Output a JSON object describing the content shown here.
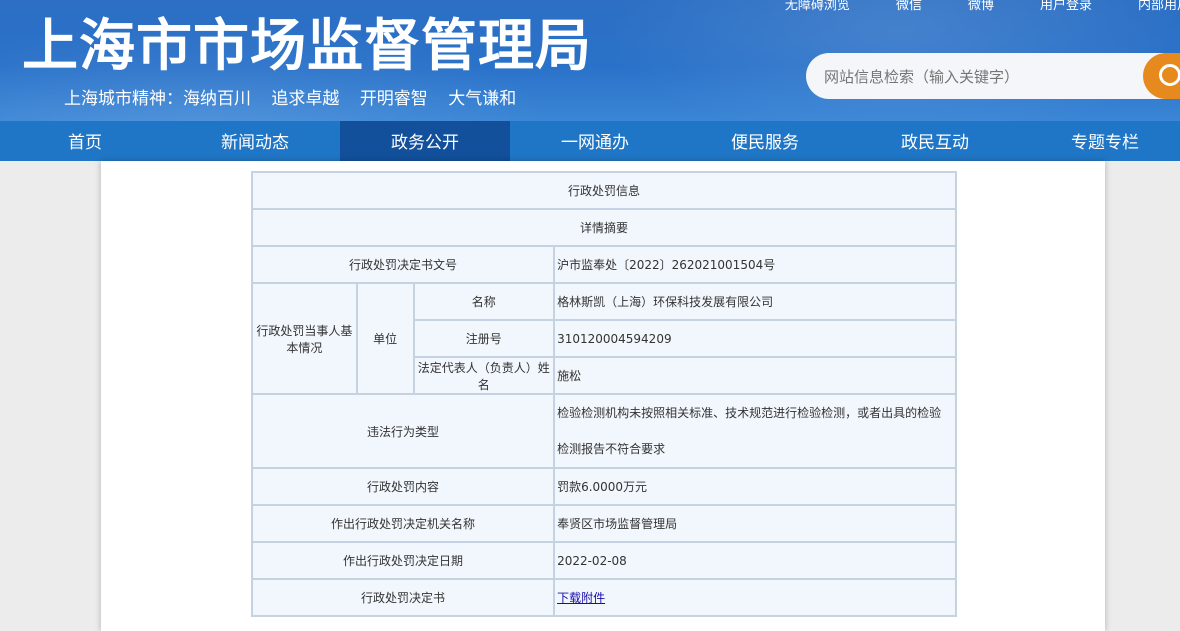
{
  "header": {
    "site_title": "上海市市场监督管理局",
    "slogan": [
      "上海城市精神：海纳百川",
      "追求卓越",
      "开明睿智",
      "大气谦和"
    ],
    "top_links": [
      "无障碍浏览",
      "微信",
      "微博",
      "用户登录",
      "内部用户"
    ],
    "search_placeholder": "网站信息检索（输入关键字）"
  },
  "nav": {
    "items": [
      "首页",
      "新闻动态",
      "政务公开",
      "一网通办",
      "便民服务",
      "政民互动",
      "专题专栏"
    ],
    "active_index": 2
  },
  "table": {
    "title": "行政处罚信息",
    "subtitle": "详情摘要",
    "doc_no_label": "行政处罚决定书文号",
    "doc_no_value": "沪市监奉处〔2022〕262021001504号",
    "party_label": "行政处罚当事人基本情况",
    "unit_label": "单位",
    "name_label": "名称",
    "name_value": "格林斯凯（上海）环保科技发展有限公司",
    "reg_label": "注册号",
    "reg_value": "310120004594209",
    "rep_label": "法定代表人（负责人）姓名",
    "rep_value": "施松",
    "violation_label": "违法行为类型",
    "violation_value": "检验检测机构未按照相关标准、技术规范进行检验检测，或者出具的检验检测报告不符合要求",
    "content_label": "行政处罚内容",
    "content_value": "罚款6.0000万元",
    "org_label": "作出行政处罚决定机关名称",
    "org_value": "奉贤区市场监督管理局",
    "date_label": "作出行政处罚决定日期",
    "date_value": "2022-02-08",
    "decision_label": "行政处罚决定书",
    "decision_link": "下载附件"
  }
}
